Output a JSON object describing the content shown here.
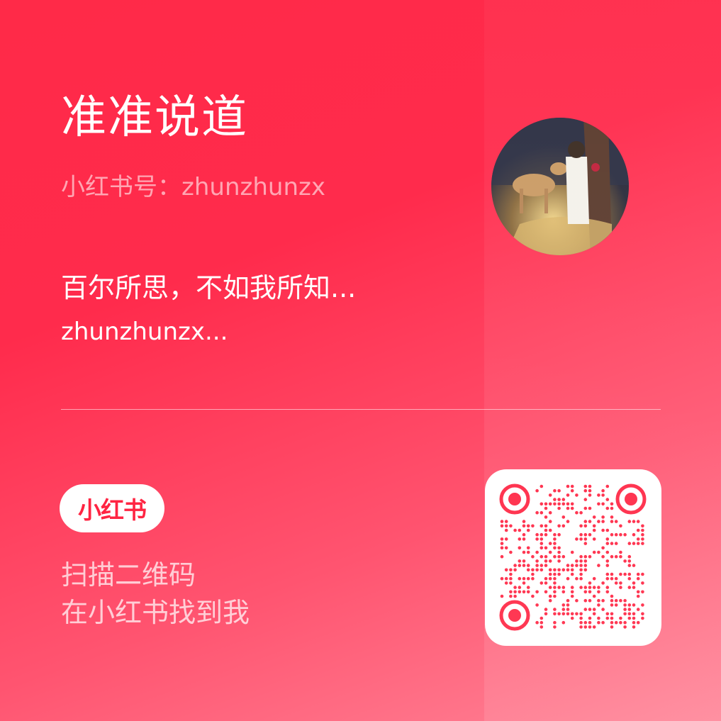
{
  "profile": {
    "name": "准准说道",
    "account_label": "小红书号：",
    "account_id": "zhunzhunzx",
    "bio_line1": "百尔所思，不如我所知...",
    "bio_line2": "zhunzhunzx..."
  },
  "brand": {
    "logo_text": "小红书",
    "accent": "#ff2442"
  },
  "scan": {
    "line1": "扫描二维码",
    "line2": "在小红书找到我"
  },
  "icons": {
    "avatar": "profile-avatar",
    "qr": "qr-code-icon"
  }
}
